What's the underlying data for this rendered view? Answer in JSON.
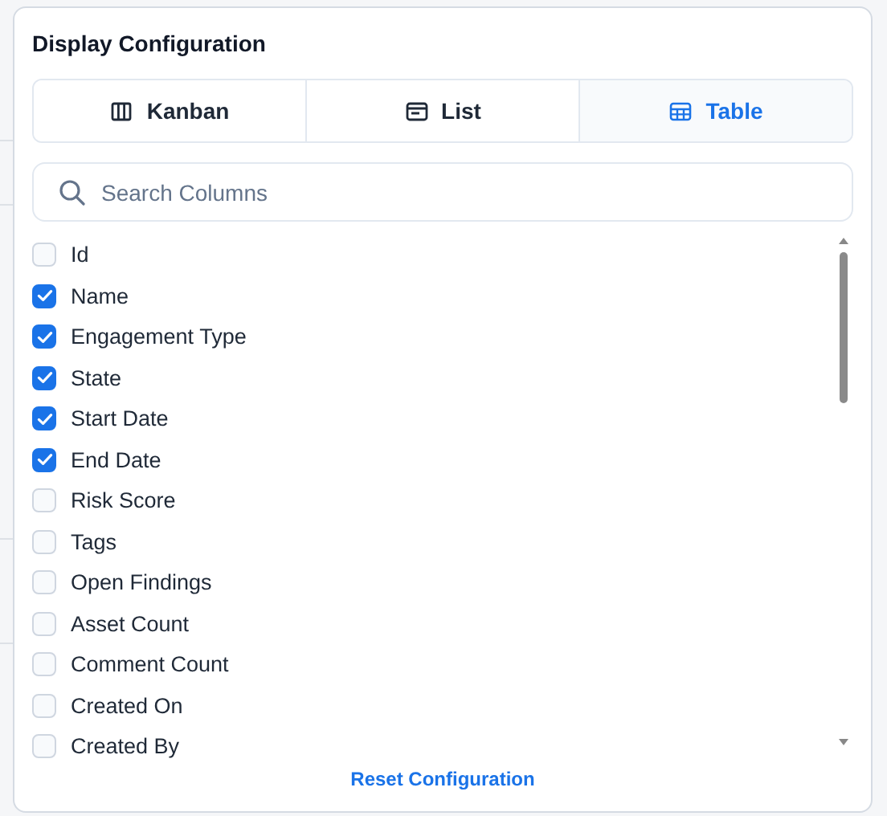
{
  "panel": {
    "title": "Display Configuration"
  },
  "views": [
    {
      "label": "Kanban",
      "kind": "kanban",
      "selected": false
    },
    {
      "label": "List",
      "kind": "list",
      "selected": false
    },
    {
      "label": "Table",
      "kind": "table",
      "selected": true
    }
  ],
  "search": {
    "placeholder": "Search Columns"
  },
  "columns": [
    {
      "label": "Id",
      "checked": false
    },
    {
      "label": "Name",
      "checked": true
    },
    {
      "label": "Engagement Type",
      "checked": true
    },
    {
      "label": "State",
      "checked": true
    },
    {
      "label": "Start Date",
      "checked": true
    },
    {
      "label": "End Date",
      "checked": true
    },
    {
      "label": "Risk Score",
      "checked": false
    },
    {
      "label": "Tags",
      "checked": false
    },
    {
      "label": "Open Findings",
      "checked": false
    },
    {
      "label": "Asset Count",
      "checked": false
    },
    {
      "label": "Comment Count",
      "checked": false
    },
    {
      "label": "Created On",
      "checked": false
    },
    {
      "label": "Created By",
      "checked": false
    }
  ],
  "reset": {
    "label": "Reset Configuration"
  }
}
